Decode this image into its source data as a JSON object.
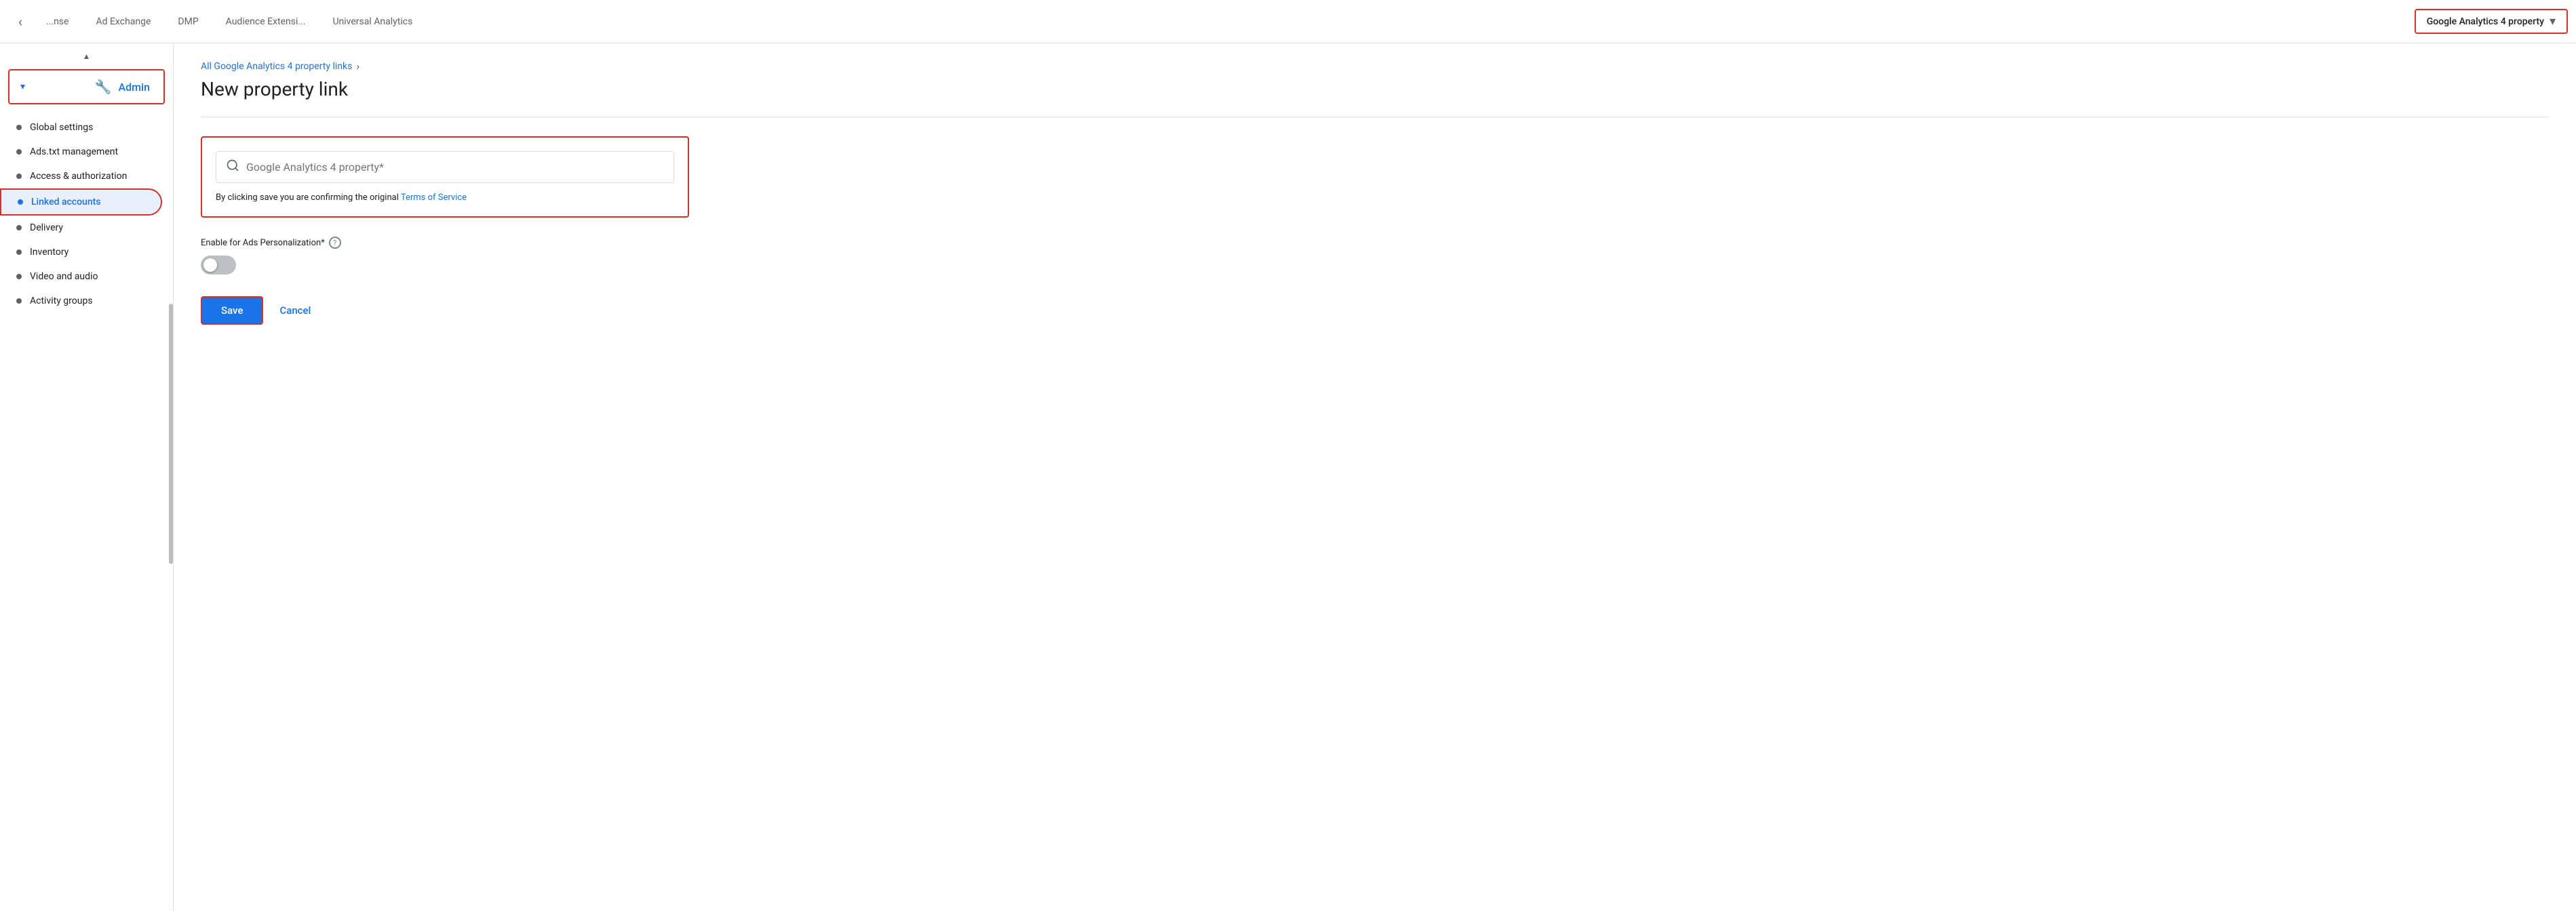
{
  "topNav": {
    "backLabel": "‹",
    "tabs": [
      {
        "id": "exchange",
        "label": "...nse",
        "active": false
      },
      {
        "id": "ad-exchange",
        "label": "Ad Exchange",
        "active": false
      },
      {
        "id": "dmp",
        "label": "DMP",
        "active": false
      },
      {
        "id": "audience",
        "label": "Audience Extensi...",
        "active": false
      },
      {
        "id": "universal-analytics",
        "label": "Universal Analytics",
        "active": false
      }
    ],
    "activeTab": {
      "label": "Google Analytics 4 property",
      "chevron": "▾"
    }
  },
  "sidebar": {
    "adminLabel": "Admin",
    "adminArrow": "▾",
    "items": [
      {
        "id": "global-settings",
        "label": "Global settings",
        "active": false
      },
      {
        "id": "ads-txt",
        "label": "Ads.txt management",
        "active": false
      },
      {
        "id": "access-auth",
        "label": "Access & authorization",
        "active": false
      },
      {
        "id": "linked-accounts",
        "label": "Linked accounts",
        "active": true
      },
      {
        "id": "delivery",
        "label": "Delivery",
        "active": false
      },
      {
        "id": "inventory",
        "label": "Inventory",
        "active": false
      },
      {
        "id": "video-audio",
        "label": "Video and audio",
        "active": false
      },
      {
        "id": "activity-groups",
        "label": "Activity groups",
        "active": false
      }
    ]
  },
  "breadcrumb": {
    "linkText": "All Google Analytics 4 property links",
    "separator": "›"
  },
  "page": {
    "title": "New property link"
  },
  "form": {
    "searchPlaceholder": "Google Analytics 4 property*",
    "tosText": "By clicking save you are confirming the original ",
    "tosLinkText": "Terms of Service",
    "toggleLabel": "Enable for Ads Personalization*",
    "helpTooltip": "?"
  },
  "actions": {
    "saveLabel": "Save",
    "cancelLabel": "Cancel"
  },
  "icons": {
    "search": "🔍",
    "wrench": "🔧",
    "back": "‹"
  }
}
